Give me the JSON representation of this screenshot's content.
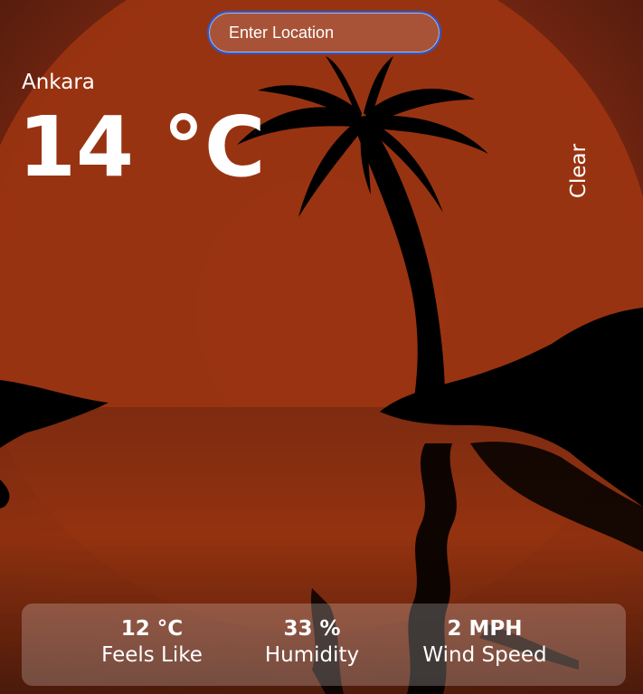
{
  "search": {
    "placeholder": "Enter Location"
  },
  "weather": {
    "city": "Ankara",
    "temperature": "14 °C",
    "condition": "Clear"
  },
  "details": {
    "feels_like_value": "12 °C",
    "feels_like_label": "Feels Like",
    "humidity_value": "33 %",
    "humidity_label": "Humidity",
    "wind_value": "2 MPH",
    "wind_label": "Wind Speed"
  },
  "colors": {
    "sun": "#9a3412",
    "sky": "#5a1f0e",
    "silhouette": "#000000",
    "input_border": "#2f56c9"
  }
}
